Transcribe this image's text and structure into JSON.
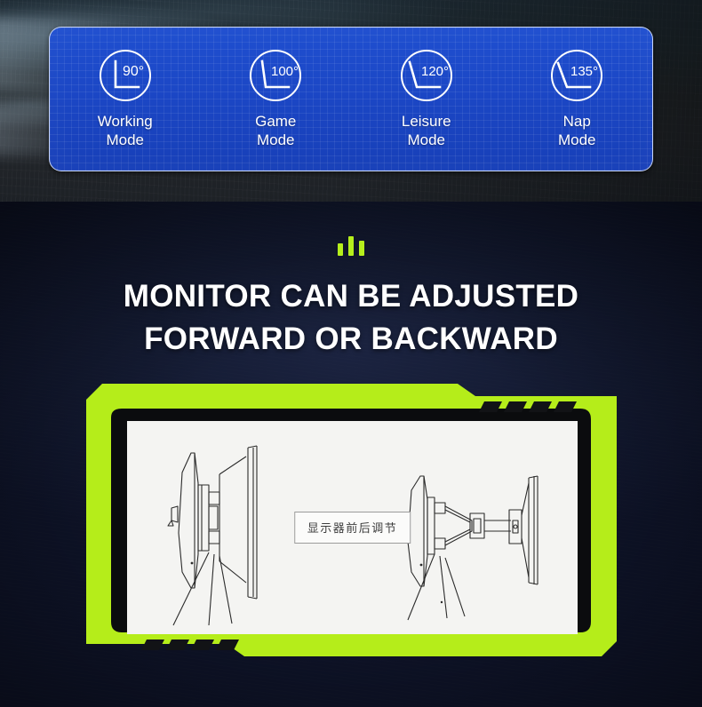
{
  "top_panel": {
    "modes": [
      {
        "angle": "90°",
        "angle_value": 90,
        "label": "Working\nMode",
        "icon": "angle-90-icon"
      },
      {
        "angle": "100°",
        "angle_value": 100,
        "label": "Game\nMode",
        "icon": "angle-100-icon"
      },
      {
        "angle": "120°",
        "angle_value": 120,
        "label": "Leisure\nMode",
        "icon": "angle-120-icon"
      },
      {
        "angle": "135°",
        "angle_value": 135,
        "label": "Nap\nMode",
        "icon": "angle-135-icon"
      }
    ],
    "panel_color": "#1b46c4",
    "text_color": "#ffffff"
  },
  "bottom_section": {
    "accent_color": "#b6ef1c",
    "headline": "MONITOR CAN BE ADJUSTED\nFORWARD OR BACKWARD",
    "device": {
      "bezel_color": "#b5ed1a",
      "inner_frame_color": "#0b0c0e",
      "screen_color": "#f4f4f2",
      "vent_count_top_right": 4,
      "vent_count_bottom_left": 4,
      "diagram": {
        "caption": "显示器前后调节",
        "left_view": "monitor-retracted-side-view",
        "right_view": "monitor-extended-side-view"
      }
    }
  }
}
